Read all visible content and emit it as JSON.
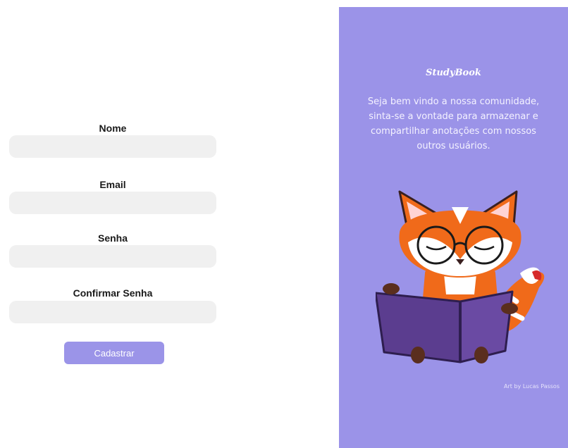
{
  "form": {
    "fields": [
      {
        "label": "Nome",
        "value": "",
        "placeholder": ""
      },
      {
        "label": "Email",
        "value": "",
        "placeholder": ""
      },
      {
        "label": "Senha",
        "value": "",
        "placeholder": ""
      },
      {
        "label": "Confirmar Senha",
        "value": "",
        "placeholder": ""
      }
    ],
    "submit_label": "Cadastrar"
  },
  "panel": {
    "brand": "StudyBook",
    "tagline": "Seja bem vindo a nossa comunidade, sinta-se a vontade para armazenar e compartilhar anotações com nossos outros usuários.",
    "credit": "Art by Lucas Passos",
    "illustration": "fox-reading-book"
  },
  "colors": {
    "accent": "#9b94e8",
    "panel_background": "#9b93e8",
    "input_background": "#f0f0f0"
  }
}
